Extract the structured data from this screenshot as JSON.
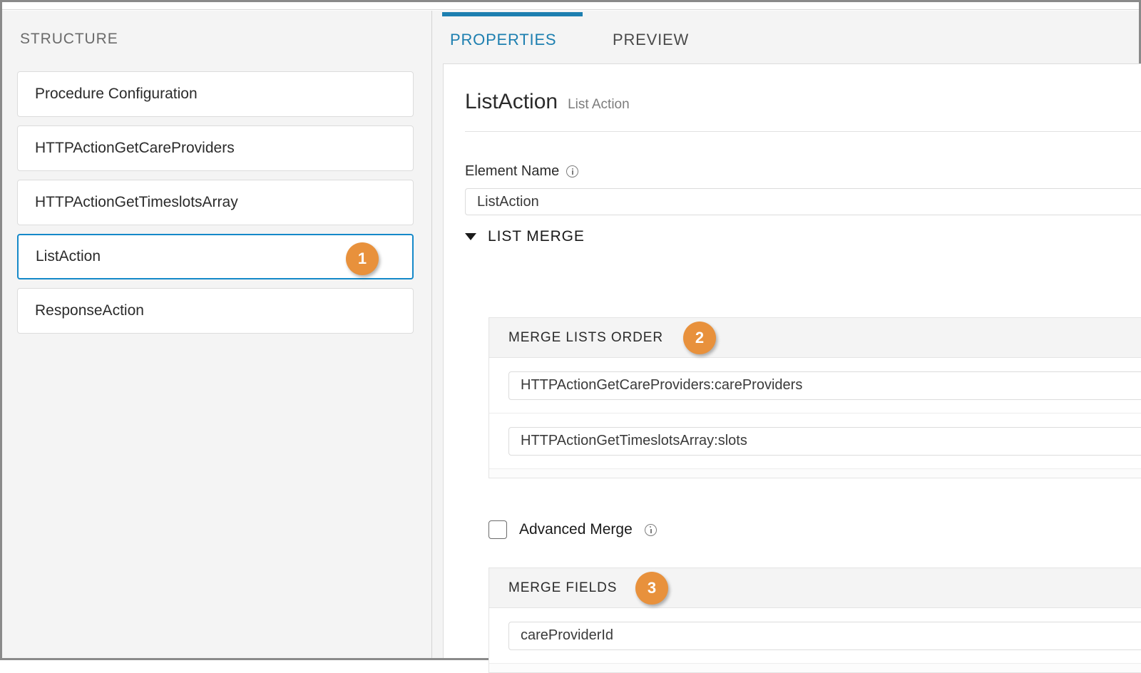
{
  "structure": {
    "title": "STRUCTURE",
    "items": [
      {
        "label": "Procedure Configuration",
        "selected": false
      },
      {
        "label": "HTTPActionGetCareProviders",
        "selected": false
      },
      {
        "label": "HTTPActionGetTimeslotsArray",
        "selected": false
      },
      {
        "label": "ListAction",
        "selected": true
      },
      {
        "label": "ResponseAction",
        "selected": false
      }
    ]
  },
  "tabs": {
    "properties": "PROPERTIES",
    "preview": "PREVIEW",
    "active": "PROPERTIES"
  },
  "card": {
    "title": "ListAction",
    "subtitle": "List Action",
    "element_name_label": "Element Name",
    "element_name_value": "ListAction",
    "element_name_placeholder": "Element Name"
  },
  "list_merge": {
    "section_label": "LIST MERGE",
    "expanded": true,
    "merge_lists_order": {
      "header": "MERGE LISTS ORDER",
      "rows": [
        {
          "value": "HTTPActionGetCareProviders:careProviders"
        },
        {
          "value": "HTTPActionGetTimeslotsArray:slots"
        }
      ]
    },
    "advanced_merge": {
      "label": "Advanced Merge",
      "checked": false
    },
    "merge_fields": {
      "header": "MERGE FIELDS",
      "rows": [
        {
          "value": "careProviderId"
        }
      ]
    }
  },
  "badges": [
    {
      "number": "1",
      "target": "structure-item-listaction"
    },
    {
      "number": "2",
      "target": "merge-lists-order-header"
    },
    {
      "number": "3",
      "target": "merge-fields-header"
    }
  ],
  "colors": {
    "accent_blue": "#1d7fb0",
    "selected_border": "#1589c9",
    "badge_orange": "#e8913c",
    "panel_bg": "#f4f4f4",
    "card_bg": "#ffffff",
    "border": "#dcdcdc"
  }
}
